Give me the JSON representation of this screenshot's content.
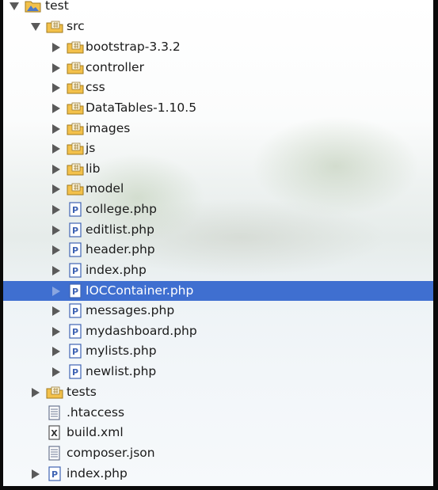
{
  "tree": {
    "root": {
      "label": "test",
      "icon": "project-folder-icon",
      "expanded": true
    },
    "src": {
      "label": "src",
      "icon": "package-folder-icon",
      "expanded": true
    },
    "src_children": [
      {
        "label": "bootstrap-3.3.2",
        "icon": "package-folder-icon",
        "expandable": true
      },
      {
        "label": "controller",
        "icon": "package-folder-icon",
        "expandable": true
      },
      {
        "label": "css",
        "icon": "package-folder-icon",
        "expandable": true
      },
      {
        "label": "DataTables-1.10.5",
        "icon": "package-folder-icon",
        "expandable": true
      },
      {
        "label": "images",
        "icon": "package-folder-icon",
        "expandable": true
      },
      {
        "label": "js",
        "icon": "package-folder-icon",
        "expandable": true
      },
      {
        "label": "lib",
        "icon": "package-folder-icon",
        "expandable": true
      },
      {
        "label": "model",
        "icon": "package-folder-icon",
        "expandable": true
      },
      {
        "label": "college.php",
        "icon": "php-file-icon",
        "expandable": true
      },
      {
        "label": "editlist.php",
        "icon": "php-file-icon",
        "expandable": true
      },
      {
        "label": "header.php",
        "icon": "php-file-icon",
        "expandable": true
      },
      {
        "label": "index.php",
        "icon": "php-file-icon",
        "expandable": true
      },
      {
        "label": "IOCContainer.php",
        "icon": "php-file-icon",
        "expandable": true,
        "selected": true
      },
      {
        "label": "messages.php",
        "icon": "php-file-icon",
        "expandable": true
      },
      {
        "label": "mydashboard.php",
        "icon": "php-file-icon",
        "expandable": true
      },
      {
        "label": "mylists.php",
        "icon": "php-file-icon",
        "expandable": true
      },
      {
        "label": "newlist.php",
        "icon": "php-file-icon",
        "expandable": true
      }
    ],
    "root_children": [
      {
        "label": "tests",
        "icon": "package-folder-icon",
        "expandable": true
      },
      {
        "label": ".htaccess",
        "icon": "text-file-icon",
        "expandable": false
      },
      {
        "label": "build.xml",
        "icon": "xml-file-icon",
        "expandable": false
      },
      {
        "label": "composer.json",
        "icon": "text-file-icon",
        "expandable": false
      },
      {
        "label": "index.php",
        "icon": "php-file-icon",
        "expandable": true
      }
    ]
  },
  "colors": {
    "selection": "#3f6fd0",
    "folder": "#f3c14b",
    "php_file": "#3f63b3"
  }
}
